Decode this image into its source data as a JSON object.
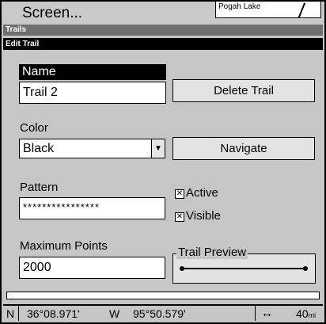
{
  "header": {
    "screen_menu": "Screen...",
    "map_label": "Pogah Lake"
  },
  "bars": {
    "trails": "Trails",
    "edit_trail": "Edit Trail"
  },
  "form": {
    "name_label": "Name",
    "name_value": "Trail 2",
    "color_label": "Color",
    "color_value": "Black",
    "pattern_label": "Pattern",
    "pattern_value": "****************",
    "max_points_label": "Maximum Points",
    "max_points_value": "2000"
  },
  "buttons": {
    "delete": "Delete Trail",
    "navigate": "Navigate"
  },
  "checkboxes": {
    "active_label": "Active",
    "active_checked": true,
    "visible_label": "Visible",
    "visible_checked": true,
    "mark": "☒"
  },
  "preview": {
    "title": "Trail Preview"
  },
  "status": {
    "lat_hemi": "N",
    "latitude": "36°08.971'",
    "lon_hemi": "W",
    "longitude": "95°50.579'",
    "scale_icon": "range-arrows-icon",
    "scale_value": "40",
    "scale_unit": "mi"
  }
}
